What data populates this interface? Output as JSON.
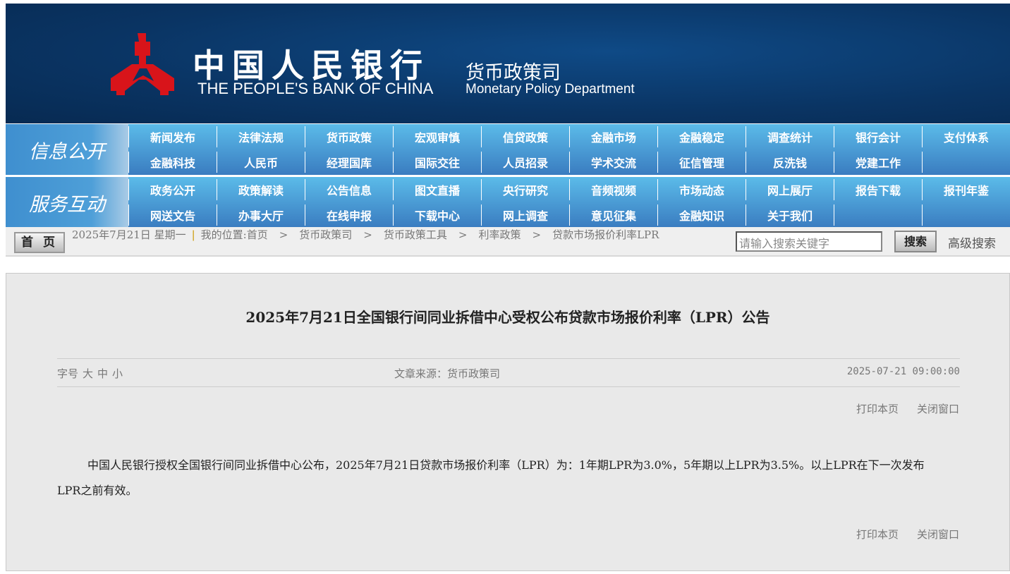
{
  "header": {
    "logo_cn": "中国人民银行",
    "logo_en": "THE PEOPLE'S BANK OF CHINA",
    "dept_cn": "货币政策司",
    "dept_en": "Monetary Policy Department"
  },
  "nav1": {
    "label": "信息公开",
    "items": [
      "新闻发布",
      "法律法规",
      "货币政策",
      "宏观审慎",
      "信贷政策",
      "金融市场",
      "金融稳定",
      "调查统计",
      "银行会计",
      "支付体系",
      "金融科技",
      "人民币",
      "经理国库",
      "国际交往",
      "人员招录",
      "学术交流",
      "征信管理",
      "反洗钱",
      "党建工作",
      ""
    ]
  },
  "nav2": {
    "label": "服务互动",
    "items": [
      "政务公开",
      "政策解读",
      "公告信息",
      "图文直播",
      "央行研究",
      "音频视频",
      "市场动态",
      "网上展厅",
      "报告下载",
      "报刊年鉴",
      "网送文告",
      "办事大厅",
      "在线申报",
      "下载中心",
      "网上调查",
      "意见征集",
      "金融知识",
      "关于我们",
      "",
      ""
    ]
  },
  "crumb": {
    "home_button": "首 页",
    "date": "2025年7月21日  星期一",
    "location": "我的位置:首页",
    "path": [
      "货币政策司",
      "货币政策工具",
      "利率政策",
      "贷款市场报价利率LPR"
    ],
    "search_placeholder": "请输入搜索关键字",
    "search_button": "搜索",
    "advanced": "高级搜索"
  },
  "article": {
    "title": "2025年7月21日全国银行间同业拆借中心受权公布贷款市场报价利率（LPR）公告",
    "font_label": "字号",
    "font_large": "大",
    "font_medium": "中",
    "font_small": "小",
    "source": "文章来源：货币政策司",
    "date": "2025-07-21 09:00:00",
    "print": "打印本页",
    "close": "关闭窗口",
    "body": "中国人民银行授权全国银行间同业拆借中心公布，2025年7月21日贷款市场报价利率（LPR）为：1年期LPR为3.0%，5年期以上LPR为3.5%。以上LPR在下一次发布LPR之前有效。"
  }
}
